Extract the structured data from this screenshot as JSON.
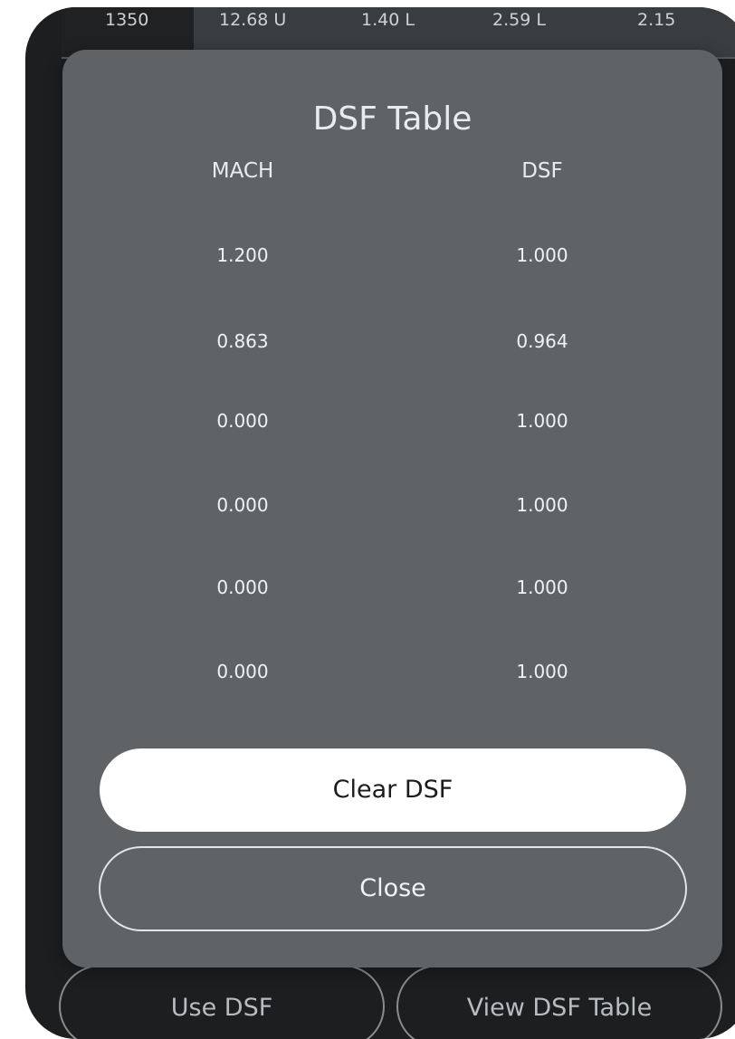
{
  "background": {
    "table_row": [
      "1350",
      "12.68 U",
      "1.40 L",
      "2.59 L",
      "2.15"
    ],
    "buttons": {
      "use_dsf": "Use DSF",
      "view_dsf_table": "View DSF Table"
    }
  },
  "modal": {
    "title": "DSF Table",
    "columns": {
      "mach": "MACH",
      "dsf": "DSF"
    },
    "rows": [
      {
        "mach": "1.200",
        "dsf": "1.000"
      },
      {
        "mach": "0.863",
        "dsf": "0.964"
      },
      {
        "mach": "0.000",
        "dsf": "1.000"
      },
      {
        "mach": "0.000",
        "dsf": "1.000"
      },
      {
        "mach": "0.000",
        "dsf": "1.000"
      },
      {
        "mach": "0.000",
        "dsf": "1.000"
      }
    ],
    "clear_label": "Clear DSF",
    "close_label": "Close"
  }
}
